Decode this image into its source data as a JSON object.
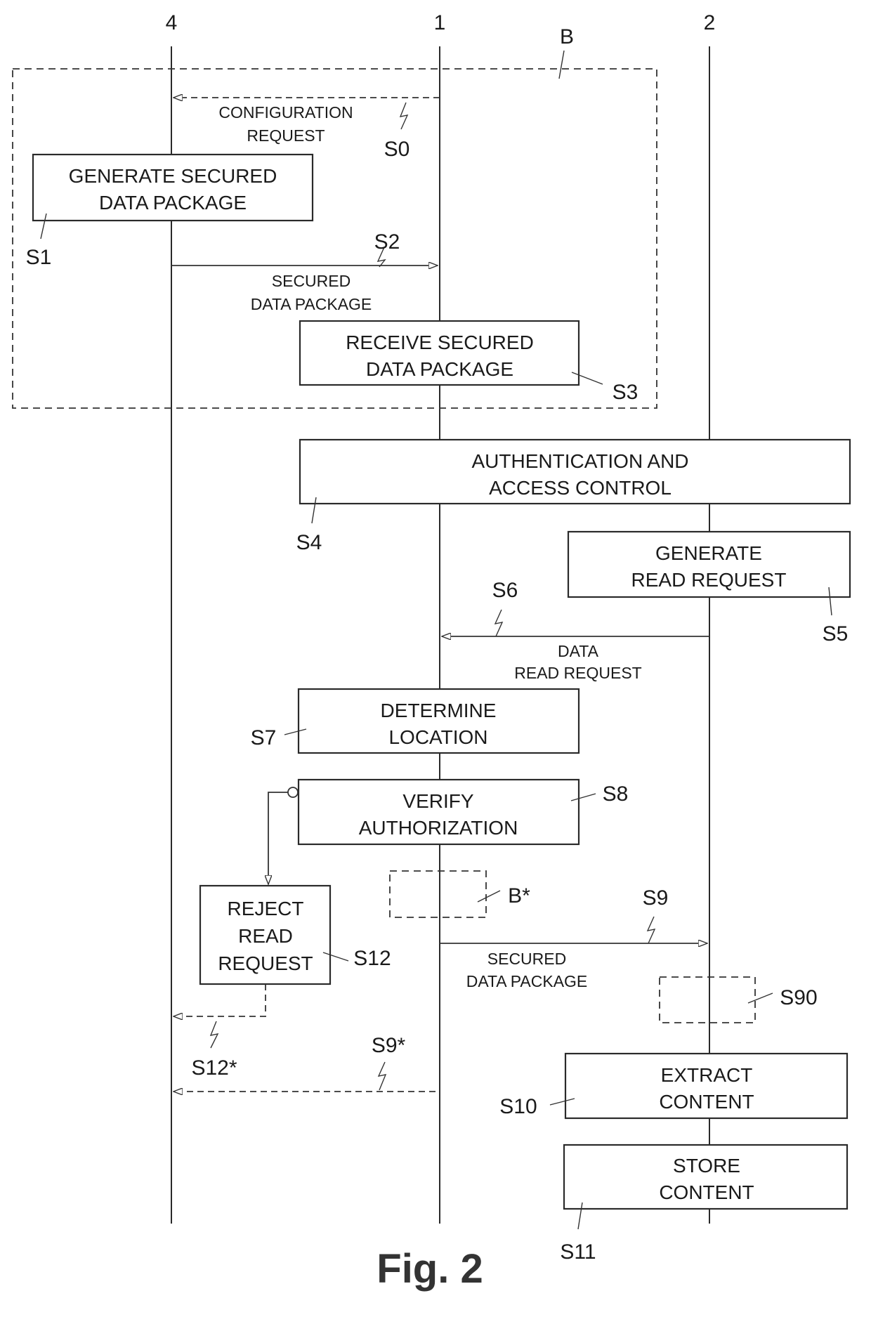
{
  "figure": {
    "caption": "Fig. 2",
    "lifelines": [
      {
        "id": "4",
        "label": "4"
      },
      {
        "id": "1",
        "label": "1"
      },
      {
        "id": "2",
        "label": "2"
      }
    ],
    "frame_label": "B",
    "steps": {
      "S1": {
        "ref": "S1",
        "lines": [
          "GENERATE SECURED",
          "DATA PACKAGE"
        ]
      },
      "S3": {
        "ref": "S3",
        "lines": [
          "RECEIVE SECURED",
          "DATA PACKAGE"
        ]
      },
      "S4": {
        "ref": "S4",
        "lines": [
          "AUTHENTICATION AND",
          "ACCESS CONTROL"
        ]
      },
      "S5": {
        "ref": "S5",
        "lines": [
          "GENERATE",
          "READ REQUEST"
        ]
      },
      "S7": {
        "ref": "S7",
        "lines": [
          "DETERMINE",
          "LOCATION"
        ]
      },
      "S8": {
        "ref": "S8",
        "lines": [
          "VERIFY",
          "AUTHORIZATION"
        ]
      },
      "S10": {
        "ref": "S10",
        "lines": [
          "EXTRACT",
          "CONTENT"
        ]
      },
      "S11": {
        "ref": "S11",
        "lines": [
          "STORE",
          "CONTENT"
        ]
      },
      "S12": {
        "ref": "S12",
        "lines": [
          "REJECT",
          "READ",
          "REQUEST"
        ]
      }
    },
    "optional_blocks": {
      "Bstar": {
        "ref": "B*"
      },
      "S90": {
        "ref": "S90"
      }
    },
    "messages": {
      "S0": {
        "ref": "S0",
        "from": "1",
        "to": "4",
        "style": "dashed",
        "lines": [
          "CONFIGURATION",
          "REQUEST"
        ]
      },
      "S2": {
        "ref": "S2",
        "from": "4",
        "to": "1",
        "style": "solid",
        "lines": [
          "SECURED",
          "DATA PACKAGE"
        ]
      },
      "S6": {
        "ref": "S6",
        "from": "2",
        "to": "1",
        "style": "solid",
        "lines": [
          "DATA",
          "READ REQUEST"
        ]
      },
      "S9": {
        "ref": "S9",
        "from": "1",
        "to": "2",
        "style": "solid",
        "lines": [
          "SECURED",
          "DATA PACKAGE"
        ]
      },
      "S9star": {
        "ref": "S9*",
        "from": "1",
        "to": "4",
        "style": "dashed"
      },
      "S12star": {
        "ref": "S12*",
        "from": "S12",
        "to": "4",
        "style": "dashed"
      }
    }
  }
}
